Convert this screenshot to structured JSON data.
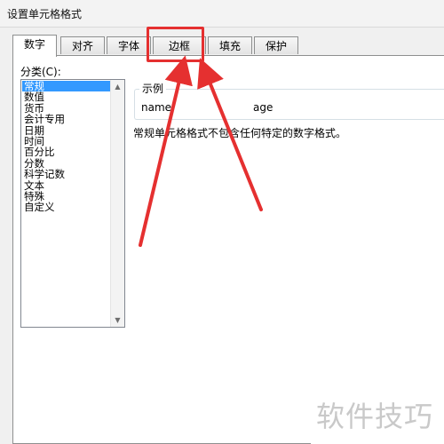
{
  "window": {
    "title": "设置单元格格式"
  },
  "tabs": [
    {
      "label": "数字",
      "active": true
    },
    {
      "label": "对齐",
      "active": false
    },
    {
      "label": "字体",
      "active": false
    },
    {
      "label": "边框",
      "active": false
    },
    {
      "label": "填充",
      "active": false
    },
    {
      "label": "保护",
      "active": false
    }
  ],
  "category": {
    "label": "分类(C):",
    "items": [
      "常规",
      "数值",
      "货币",
      "会计专用",
      "日期",
      "时间",
      "百分比",
      "分数",
      "科学记数",
      "文本",
      "特殊",
      "自定义"
    ],
    "selected": "常规"
  },
  "sample": {
    "label": "示例",
    "name": "name",
    "age": "age"
  },
  "description": "常规单元格格式不包含任何特定的数字格式。",
  "annotation": {
    "color": "#e53030"
  },
  "watermark": "软件技巧",
  "colors": {
    "selection": "#3399ff",
    "dialog_bg": "#f0f0f0",
    "panel_bg": "#ffffff"
  }
}
